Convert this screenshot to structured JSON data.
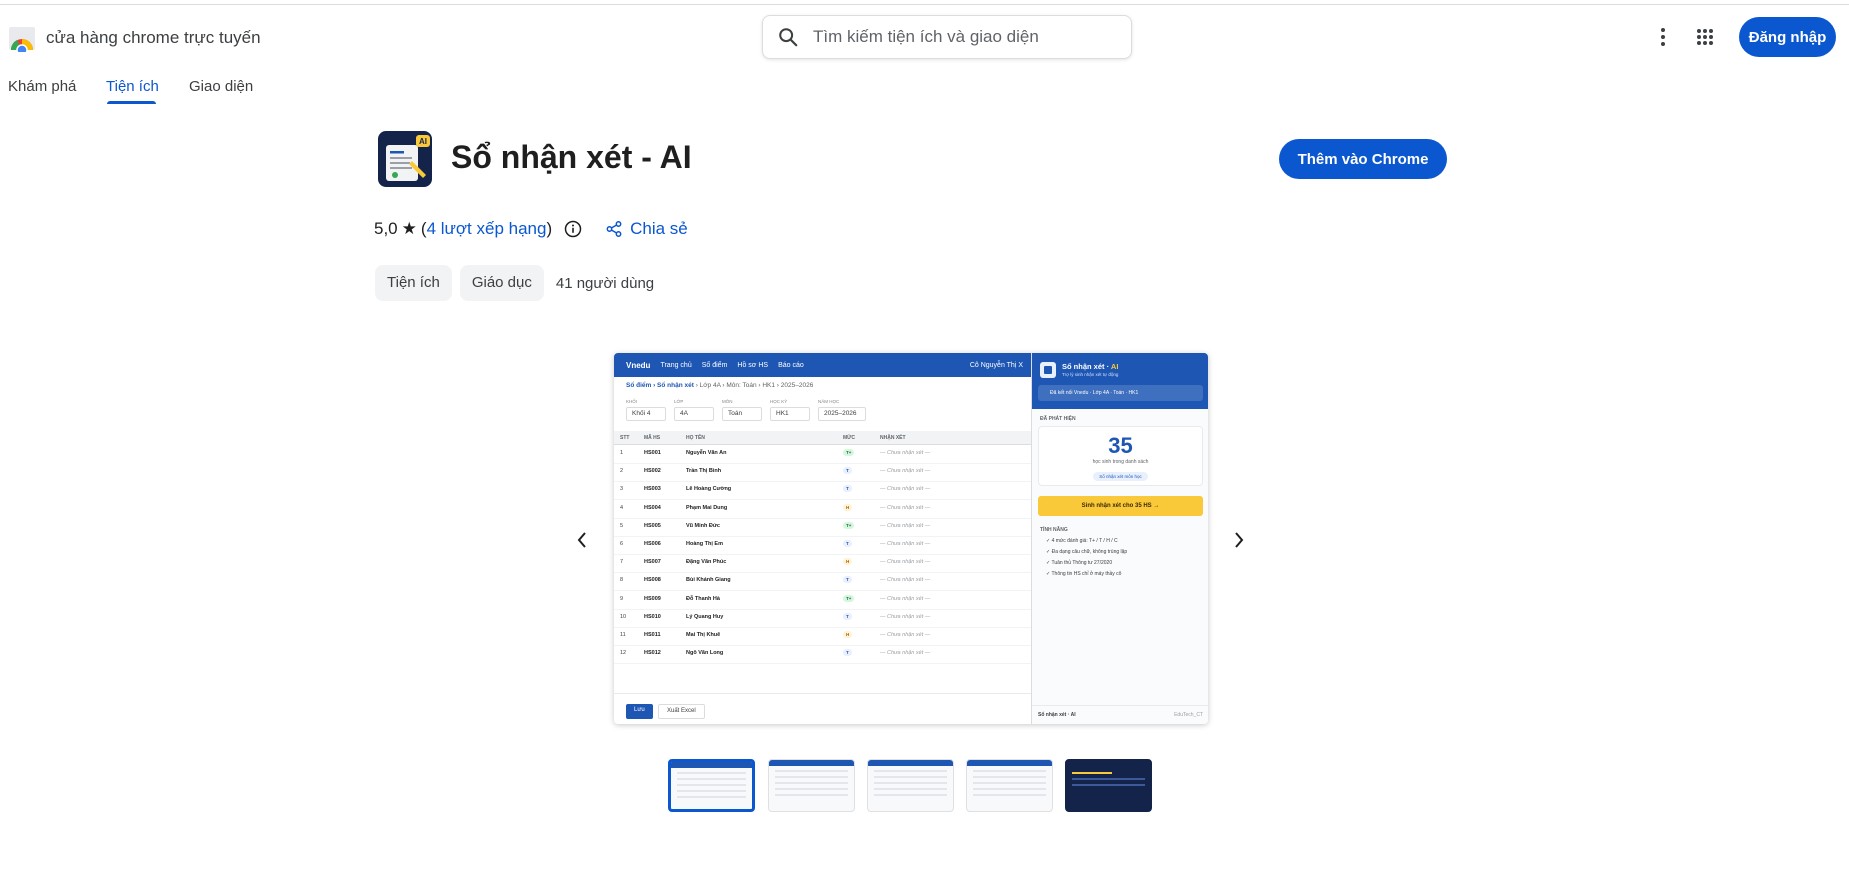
{
  "header": {
    "store_name": "cửa hàng chrome trực tuyến",
    "search_placeholder": "Tìm kiếm tiện ích và giao diện",
    "signin_label": "Đăng nhập"
  },
  "tabs": [
    {
      "label": "Khám phá",
      "active": false
    },
    {
      "label": "Tiện ích",
      "active": true
    },
    {
      "label": "Giao diện",
      "active": false
    }
  ],
  "item": {
    "title": "Sổ nhận xét - AI",
    "add_button": "Thêm vào Chrome",
    "rating": "5,0",
    "rating_star": "★",
    "ratings_link": "4 lượt xếp hạng",
    "share_label": "Chia sẻ",
    "chips": [
      "Tiện ích",
      "Giáo dục"
    ],
    "users": "41 người dùng"
  },
  "screenshot": {
    "nav": {
      "brand": "Vnedu",
      "links": [
        "Trang chủ",
        "Sổ điểm",
        "Hồ sơ HS",
        "Báo cáo"
      ],
      "user": "Cô Nguyễn Thị X"
    },
    "breadcrumb_bold": "Sổ điểm › Sổ nhận xét",
    "breadcrumb_rest": " › Lớp 4A › Môn: Toán › HK1 › 2025–2026",
    "filters": [
      {
        "label": "KHỐI",
        "value": "Khối 4"
      },
      {
        "label": "LỚP",
        "value": "4A"
      },
      {
        "label": "MÔN",
        "value": "Toán"
      },
      {
        "label": "HỌC KỲ",
        "value": "HK1"
      },
      {
        "label": "NĂM HỌC",
        "value": "2025–2026"
      }
    ],
    "columns": [
      "STT",
      "MÃ HS",
      "HỌ TÊN",
      "MỨC",
      "NHẬN XÉT"
    ],
    "rows": [
      {
        "stt": "1",
        "id": "HS001",
        "name": "Nguyễn Văn An",
        "level": "T+",
        "comment": "— Chưa nhận xét —"
      },
      {
        "stt": "2",
        "id": "HS002",
        "name": "Trần Thị Bình",
        "level": "T",
        "comment": "— Chưa nhận xét —"
      },
      {
        "stt": "3",
        "id": "HS003",
        "name": "Lê Hoàng Cường",
        "level": "T",
        "comment": "— Chưa nhận xét —"
      },
      {
        "stt": "4",
        "id": "HS004",
        "name": "Phạm Mai Dung",
        "level": "H",
        "comment": "— Chưa nhận xét —"
      },
      {
        "stt": "5",
        "id": "HS005",
        "name": "Vũ Minh Đức",
        "level": "T+",
        "comment": "— Chưa nhận xét —"
      },
      {
        "stt": "6",
        "id": "HS006",
        "name": "Hoàng Thị Em",
        "level": "T",
        "comment": "— Chưa nhận xét —"
      },
      {
        "stt": "7",
        "id": "HS007",
        "name": "Đặng Văn Phúc",
        "level": "H",
        "comment": "— Chưa nhận xét —"
      },
      {
        "stt": "8",
        "id": "HS008",
        "name": "Bùi Khánh Giang",
        "level": "T",
        "comment": "— Chưa nhận xét —"
      },
      {
        "stt": "9",
        "id": "HS009",
        "name": "Đỗ Thanh Hà",
        "level": "T+",
        "comment": "— Chưa nhận xét —"
      },
      {
        "stt": "10",
        "id": "HS010",
        "name": "Lý Quang Huy",
        "level": "T",
        "comment": "— Chưa nhận xét —"
      },
      {
        "stt": "11",
        "id": "HS011",
        "name": "Mai Thị Khuê",
        "level": "H",
        "comment": "— Chưa nhận xét —"
      },
      {
        "stt": "12",
        "id": "HS012",
        "name": "Ngô Văn Long",
        "level": "T",
        "comment": "— Chưa nhận xét —"
      }
    ],
    "footer_buttons": [
      "Lưu",
      "Xuất Excel"
    ],
    "panel": {
      "title": "Sổ nhận xét · ",
      "title_ai": "AI",
      "subtitle": "Trợ lý sinh nhận xét tự động",
      "connection": "Đã kết nối Vnedu · Lớp 4A · Toán · HK1",
      "detected_label": "ĐÃ PHÁT HIỆN",
      "count": "35",
      "count_label": "học sinh trong danh sách",
      "pill": "Sổ nhận xét môn học",
      "cta": "Sinh nhận xét cho 35 HS →",
      "features_label": "TÍNH NĂNG",
      "features": [
        "✓ 4 mức đánh giá: T+ / T / H / C",
        "✓ Đa dạng câu chữ, không trùng lặp",
        "✓ Tuân thủ Thông tư 27/2020",
        "✓ Thông tin HS chỉ ở máy thầy cô"
      ],
      "footer_left": "Sổ nhận xét · AI",
      "footer_right": "EduTech_CT"
    }
  },
  "colors": {
    "accent": "#0b57d0",
    "screenshot_blue": "#1e56b4",
    "highlight": "#f9c93a"
  }
}
